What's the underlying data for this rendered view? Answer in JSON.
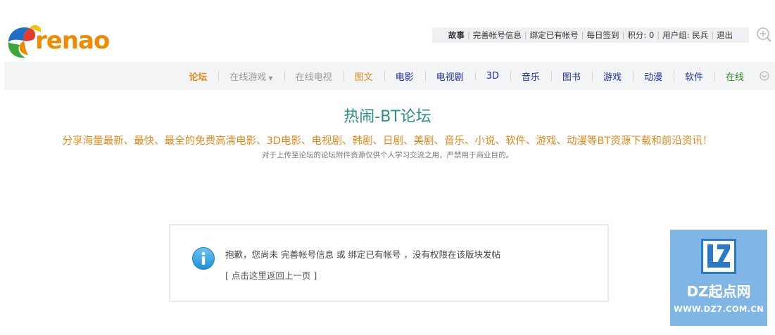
{
  "logo": {
    "text": "renao"
  },
  "userbar": {
    "items": [
      "故事",
      "完善帐号信息",
      "绑定已有帐号",
      "每日签到",
      "积分: 0",
      "用户组: 民兵",
      "退出"
    ]
  },
  "nav": {
    "items": [
      {
        "label": "论坛",
        "color": "#e08a1c",
        "bold": true
      },
      {
        "label": "在线游戏",
        "color": "#999999",
        "caret": true
      },
      {
        "label": "在线电视",
        "color": "#999999"
      },
      {
        "label": "图文",
        "color": "#e08a1c"
      },
      {
        "label": "电影",
        "color": "#1a2fa0"
      },
      {
        "label": "电视剧",
        "color": "#1a2fa0"
      },
      {
        "label": "3D",
        "color": "#1a2fa0"
      },
      {
        "label": "音乐",
        "color": "#1a2fa0"
      },
      {
        "label": "图书",
        "color": "#1a2fa0"
      },
      {
        "label": "游戏",
        "color": "#1a2fa0"
      },
      {
        "label": "动漫",
        "color": "#1a2fa0"
      },
      {
        "label": "软件",
        "color": "#1a2fa0"
      },
      {
        "label": "在线",
        "color": "#2a8a1a"
      }
    ]
  },
  "banner": {
    "title": "热闹-BT论坛",
    "slogan": "分享海量最新、最快、最全的免费高清电影、3D电影、电视剧、韩剧、日剧、美剧、音乐、小说、软件、游戏、动漫等BT资源下载和前沿资讯！",
    "disclaimer": "对于上传至论坛的论坛附件资源仅供个人学习交流之用，严禁用于商业目的。"
  },
  "message": {
    "prefix": "抱歉，您尚未",
    "link1": "完善帐号信息",
    "or": "或",
    "link2": "绑定已有帐号",
    "suffix": "，没有权限在该版块发帖",
    "back": "[ 点击这里返回上一页 ]"
  },
  "watermark": {
    "brand": "DZ起点网",
    "url": "WWW.DZ7.COM.CN"
  }
}
